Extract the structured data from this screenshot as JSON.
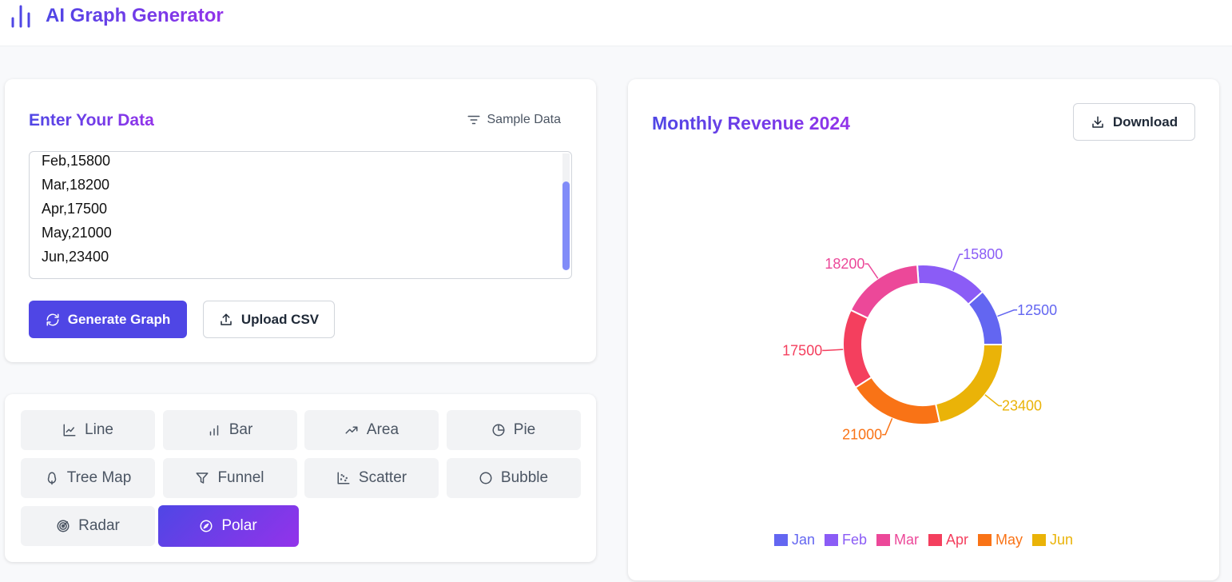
{
  "header": {
    "title": "AI Graph Generator",
    "logo_icon": "bar-chart-icon"
  },
  "input_card": {
    "title": "Enter Your Data",
    "sample_label": "Sample Data",
    "textarea_lines": [
      "Feb,15800",
      "Mar,18200",
      "Apr,17500",
      "May,21000",
      "Jun,23400"
    ],
    "generate_label": "Generate Graph",
    "upload_label": "Upload CSV"
  },
  "chart_types": [
    {
      "label": "Line",
      "icon": "line-chart-icon"
    },
    {
      "label": "Bar",
      "icon": "bar-chart-icon"
    },
    {
      "label": "Area",
      "icon": "trending-up-icon"
    },
    {
      "label": "Pie",
      "icon": "pie-chart-icon"
    },
    {
      "label": "Tree Map",
      "icon": "tree-icon"
    },
    {
      "label": "Funnel",
      "icon": "funnel-icon"
    },
    {
      "label": "Scatter",
      "icon": "scatter-icon"
    },
    {
      "label": "Bubble",
      "icon": "circle-icon"
    },
    {
      "label": "Radar",
      "icon": "radar-icon"
    },
    {
      "label": "Polar",
      "icon": "compass-icon",
      "active": true
    }
  ],
  "chart_card": {
    "title": "Monthly Revenue 2024",
    "download_label": "Download"
  },
  "chart_data": {
    "type": "doughnut",
    "title": "Monthly Revenue 2024",
    "categories": [
      "Jan",
      "Feb",
      "Mar",
      "Apr",
      "May",
      "Jun"
    ],
    "values": [
      12500,
      15800,
      18200,
      17500,
      21000,
      23400
    ],
    "colors": [
      "#6366f1",
      "#8b5cf6",
      "#ec4899",
      "#f43f5e",
      "#f97316",
      "#eab308"
    ],
    "legend": "bottom",
    "data_labels": true
  }
}
